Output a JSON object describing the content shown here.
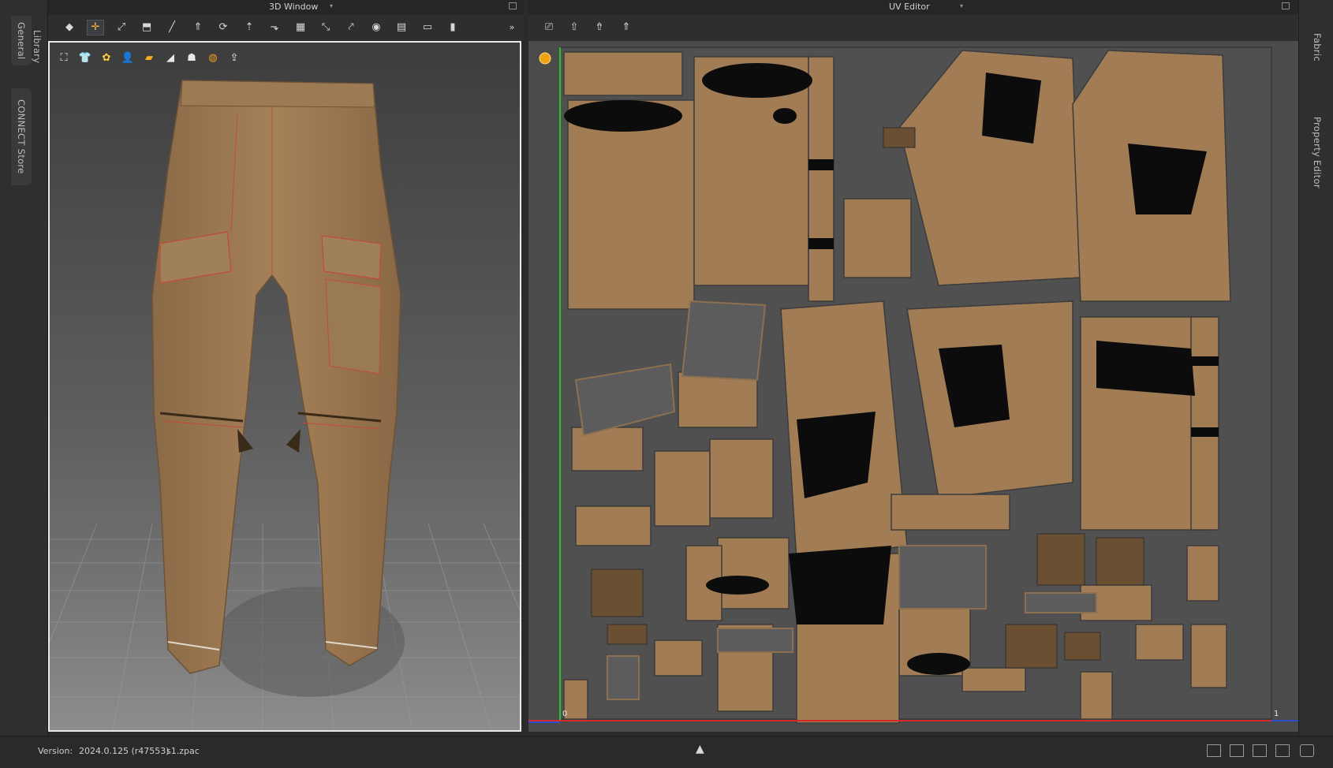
{
  "left_tabs": {
    "general": "General",
    "library": "Library",
    "connect": "CONNECT Store"
  },
  "right_tabs": {
    "fabric": "Fabric",
    "property": "Property Editor"
  },
  "window_3d": {
    "title": "3D Window",
    "toolbar_icons": [
      "select-mesh-icon",
      "transform-icon",
      "select-pin-icon",
      "fold-arrange-icon",
      "edit-stitch-icon",
      "avatar-arrange-icon",
      "rotate-icon",
      "tack-icon",
      "measure-icon",
      "grid-icon",
      "ruler-icon",
      "pin-icon",
      "point-icon",
      "layer-icon",
      "flatten-icon",
      "export-icon"
    ],
    "viewport_icons": [
      "garment-view-icon",
      "shirt-view-icon",
      "texture-view-icon",
      "avatar-view-icon",
      "fabric-color-icon",
      "arrow-view-icon",
      "silhouette-icon",
      "sphere-render-icon",
      "upload-icon"
    ]
  },
  "uv_editor": {
    "title": "UV Editor",
    "toolbar_icons": [
      "uv-snapshot-icon",
      "uv-bake-icon",
      "uv-pack-icon",
      "uv-arrange-icon"
    ],
    "axis_origin": "0",
    "axis_max": "1"
  },
  "status": {
    "version_label": "Version:",
    "version_value": "2024.0.125 (r47553)",
    "filename": "s1.zpac"
  },
  "colors": {
    "fabric": "#a37e56",
    "fabric_dark": "#6e5238",
    "uv_background": "#4b4b4b",
    "u_axis": "#d42a2a",
    "v_axis": "#2cc42c",
    "edge_axis": "#2d4ecf"
  }
}
